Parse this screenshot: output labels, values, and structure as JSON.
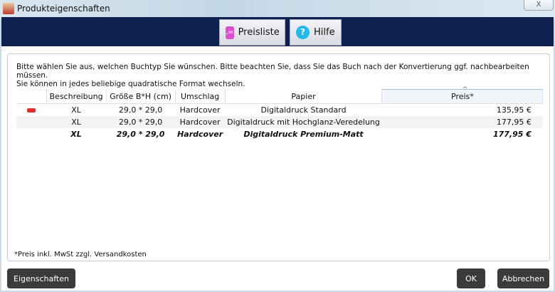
{
  "window": {
    "title": "Produkteigenschaften",
    "close": "X"
  },
  "toolbar": {
    "pricelist": "Preisliste",
    "help": "Hilfe"
  },
  "intro": [
    "Bitte wählen Sie aus, welchen Buchtyp Sie wünschen. Bitte beachten Sie, dass Sie das Buch nach der Konvertierung ggf. nachbearbeiten müssen.",
    "Sie können in jedes beliebige quadratische Format wechseln."
  ],
  "table": {
    "headers": [
      "Beschreibung",
      "Größe B*H (cm)",
      "Umschlag",
      "Papier",
      "Preis*"
    ],
    "rows": [
      [
        "XL",
        "29,0 * 29,0",
        "Hardcover",
        "Digitaldruck Standard",
        "135,95 €"
      ],
      [
        "XL",
        "29,0 * 29,0",
        "Hardcover",
        "Digitaldruck mit Hochglanz-Veredelung",
        "177,95 €"
      ],
      [
        "XL",
        "29,0 * 29,0",
        "Hardcover",
        "Digitaldruck Premium-Matt",
        "177,95 €"
      ]
    ]
  },
  "footnote": "*Preis inkl. MwSt zzgl. Versandkosten",
  "buttons": {
    "properties": "Eigenschaften",
    "ok": "OK",
    "cancel": "Abbrechen"
  }
}
